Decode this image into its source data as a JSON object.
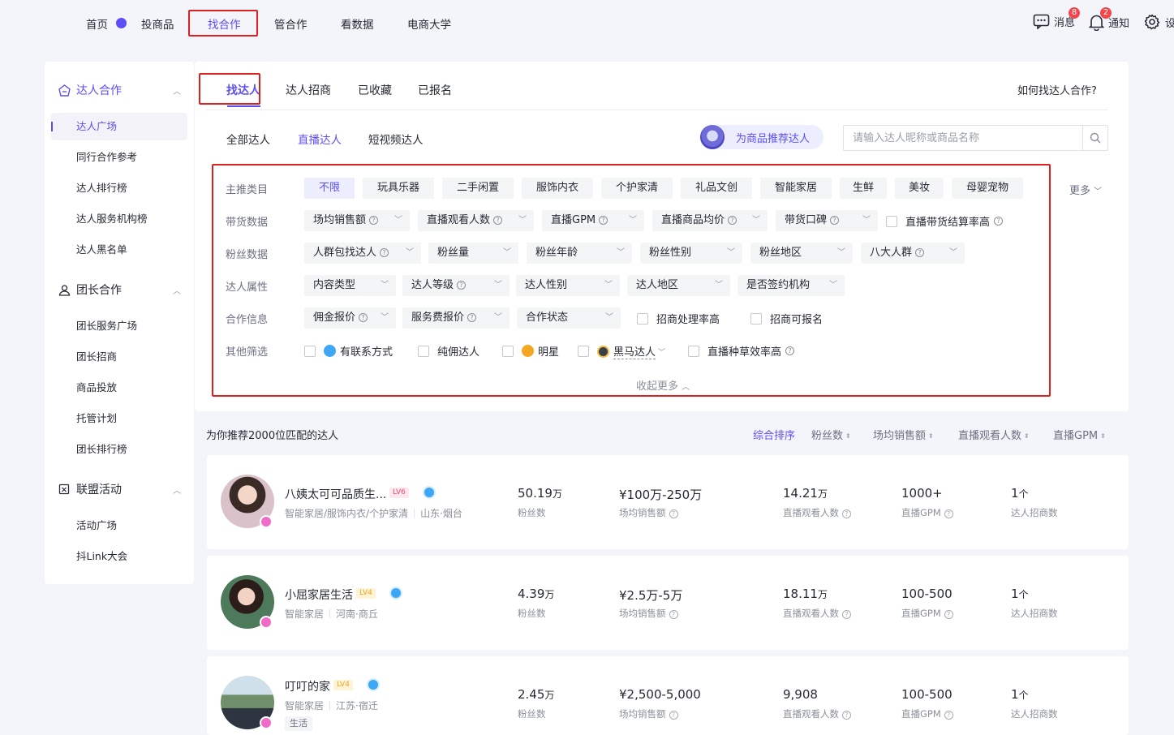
{
  "topnav": {
    "items": [
      "首页",
      "投商品",
      "找合作",
      "管合作",
      "看数据",
      "电商大学"
    ],
    "right": {
      "messages_label": "消息",
      "messages_count": "8",
      "notify_label": "通知",
      "notify_count": "2",
      "settings_label": "设"
    }
  },
  "sidebar": {
    "groups": [
      {
        "label": "达人合作",
        "items": [
          "达人广场",
          "同行合作参考",
          "达人排行榜",
          "达人服务机构榜",
          "达人黑名单"
        ]
      },
      {
        "label": "团长合作",
        "items": [
          "团长服务广场",
          "团长招商",
          "商品投放",
          "托管计划",
          "团长排行榜"
        ]
      },
      {
        "label": "联盟活动",
        "items": [
          "活动广场",
          "抖Link大会"
        ]
      }
    ]
  },
  "main": {
    "tabs": [
      "找达人",
      "达人招商",
      "已收藏",
      "已报名"
    ],
    "help_link": "如何找达人合作?",
    "subtabs": [
      "全部达人",
      "直播达人",
      "短视频达人"
    ],
    "recommend_button": "为商品推荐达人",
    "search_placeholder": "请输入达人昵称或商品名称",
    "filters": {
      "row1_label": "主推类目",
      "categories": [
        "不限",
        "玩具乐器",
        "二手闲置",
        "服饰内衣",
        "个护家清",
        "礼品文创",
        "智能家居",
        "生鲜",
        "美妆",
        "母婴宠物"
      ],
      "more": "更多",
      "row2_label": "带货数据",
      "row2": [
        "场均销售额",
        "直播观看人数",
        "直播GPM",
        "直播商品均价",
        "带货口碑"
      ],
      "row2_check": "直播带货结算率高",
      "row3_label": "粉丝数据",
      "row3": [
        "人群包找达人",
        "粉丝量",
        "粉丝年龄",
        "粉丝性别",
        "粉丝地区",
        "八大人群"
      ],
      "row4_label": "达人属性",
      "row4": [
        "内容类型",
        "达人等级",
        "达人性别",
        "达人地区",
        "是否签约机构"
      ],
      "row5_label": "合作信息",
      "row5": [
        "佣金报价",
        "服务费报价",
        "合作状态"
      ],
      "row5_checks": [
        "招商处理率高",
        "招商可报名"
      ],
      "row6_label": "其他筛选",
      "row6_checks": [
        "有联系方式",
        "纯佣达人",
        "明星",
        "黑马达人",
        "直播种草效率高"
      ],
      "collapse": "收起更多"
    }
  },
  "results": {
    "count_text": "为你推荐2000位匹配的达人",
    "sorts": [
      "综合排序",
      "粉丝数",
      "场均销售额",
      "直播观看人数",
      "直播GPM"
    ],
    "stat_labels": [
      "粉丝数",
      "场均销售额",
      "直播观看人数",
      "直播GPM",
      "达人招商数"
    ],
    "cards": [
      {
        "name": "八姨太可可品质生...",
        "level": "LV6",
        "categories": "智能家居/服饰内衣/个护家清",
        "region": "山东·烟台",
        "fans": "50.19",
        "fans_unit": "万",
        "sales": "¥100万-250万",
        "viewers": "14.21",
        "viewers_unit": "万",
        "gpm": "1000+",
        "merchants": "1",
        "merchants_unit": "个"
      },
      {
        "name": "小屈家居生活",
        "level": "LV4",
        "categories": "智能家居",
        "region": "河南·商丘",
        "fans": "4.39",
        "fans_unit": "万",
        "sales": "¥2.5万-5万",
        "viewers": "18.11",
        "viewers_unit": "万",
        "gpm": "100-500",
        "merchants": "1",
        "merchants_unit": "个"
      },
      {
        "name": "叮叮的家",
        "level": "LV4",
        "categories": "智能家居",
        "region": "江苏·宿迁",
        "tag": "生活",
        "fans": "2.45",
        "fans_unit": "万",
        "sales": "¥2,500-5,000",
        "viewers": "9,908",
        "viewers_unit": "",
        "gpm": "100-500",
        "merchants": "1",
        "merchants_unit": "个"
      }
    ]
  },
  "colors": {
    "accent": "#5b4ef6",
    "highlight": "#e02020",
    "background": "#f4f5fa"
  }
}
